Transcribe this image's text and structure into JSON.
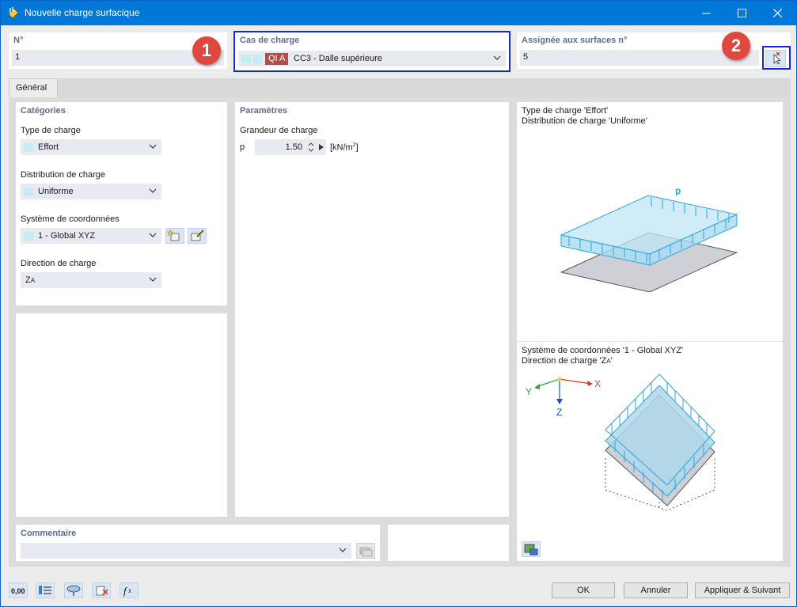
{
  "window": {
    "title": "Nouvelle charge surfacique"
  },
  "fields": {
    "no_label": "N°",
    "no_value": "1",
    "loadcase_label": "Cas de charge",
    "loadcase_tag": "QI A",
    "loadcase_value": "CC3 - Dalle supérieure",
    "assigned_label": "Assignée aux surfaces n°",
    "assigned_value": "5"
  },
  "badges": {
    "one": "1",
    "two": "2"
  },
  "tabs": {
    "general": "Général"
  },
  "categories": {
    "title": "Catégories",
    "load_type_label": "Type de charge",
    "load_type_value": "Effort",
    "distribution_label": "Distribution de charge",
    "distribution_value": "Uniforme",
    "coord_label": "Système de coordonnées",
    "coord_value": "1 - Global XYZ",
    "direction_label": "Direction de charge",
    "direction_value": "Z",
    "direction_sub": "A"
  },
  "parameters": {
    "title": "Paramètres",
    "magnitude_label": "Grandeur de charge",
    "p_symbol": "p",
    "p_value": "1.50",
    "p_unit": "[kN/m",
    "p_unit_exp": "2",
    "p_unit_close": "]"
  },
  "info": {
    "line1": "Type de charge 'Effort'",
    "line2": "Distribution de charge 'Uniforme'",
    "diagram_p": "p",
    "line3": "Système de coordonnées '1 - Global XYZ'",
    "line4_prefix": "Direction de charge 'Z",
    "line4_sub": "A",
    "line4_suffix": "'",
    "axis_x": "X",
    "axis_y": "Y",
    "axis_z": "Z"
  },
  "comment": {
    "label": "Commentaire",
    "value": ""
  },
  "buttons": {
    "ok": "OK",
    "cancel": "Annuler",
    "apply_next": "Appliquer & Suivant"
  },
  "toolbar": {
    "units_value": "0,00"
  },
  "colors": {
    "title_blue": "#0078d7",
    "label_blue": "#5a6e8c",
    "highlight": "#1a25d6",
    "badge_red": "#e0473d",
    "load_cyan": "#2ea3dd",
    "tag_red": "#b94a4a"
  }
}
